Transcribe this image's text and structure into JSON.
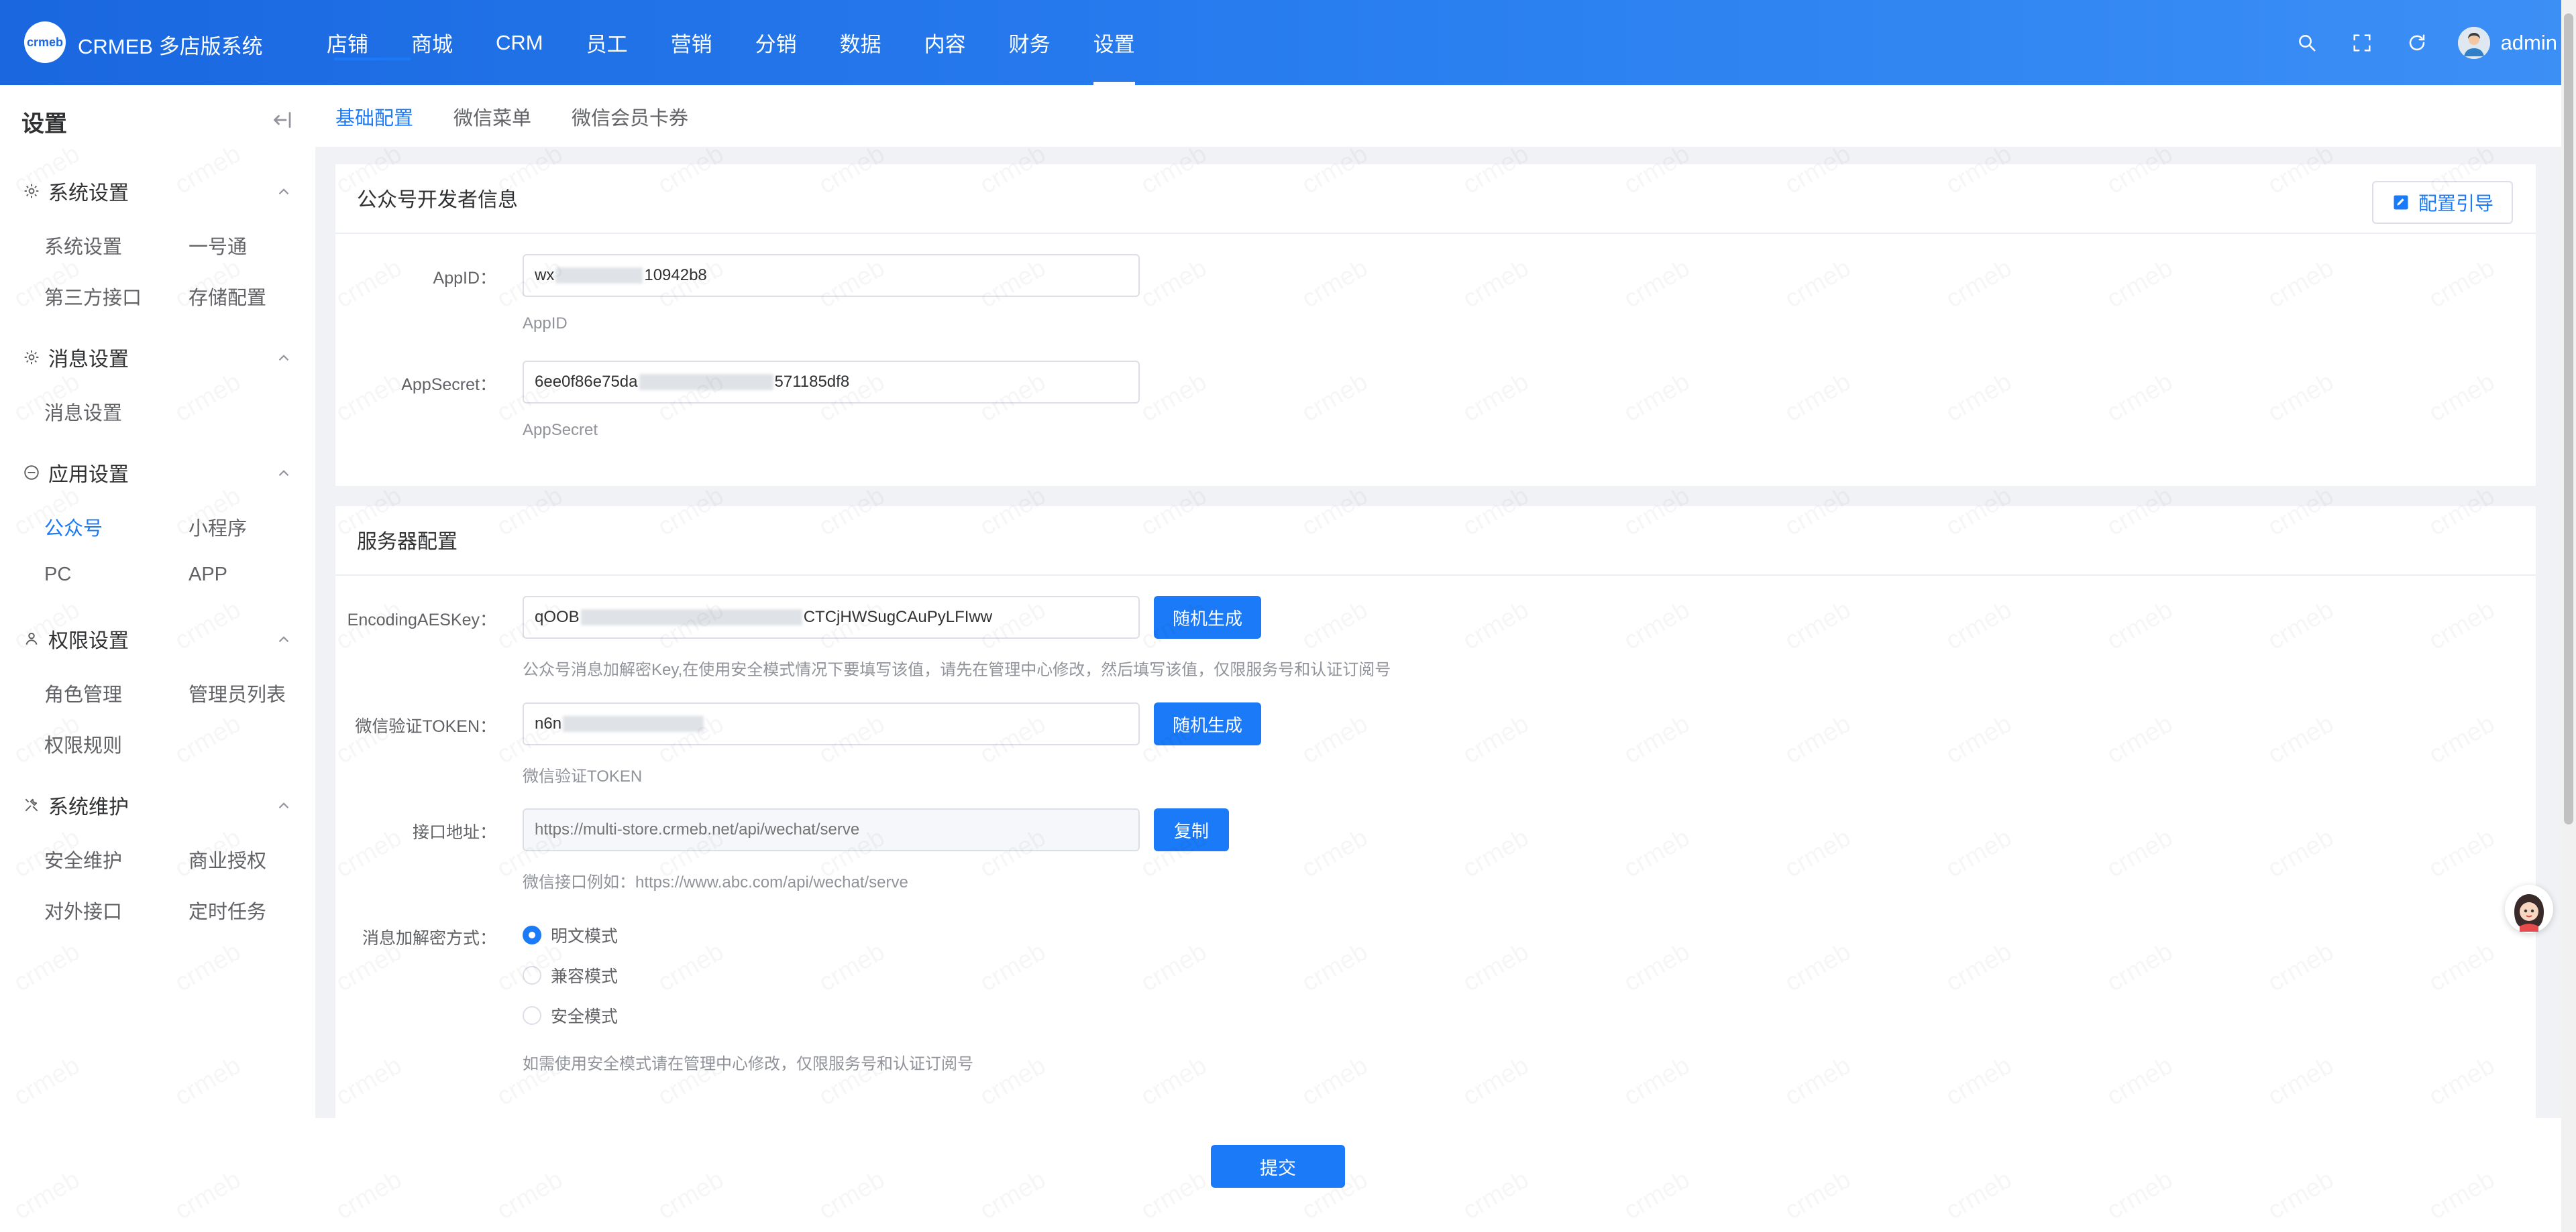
{
  "app": {
    "logo_text": "crmeb",
    "brand": "CRMEB 多店版系统"
  },
  "topnav": [
    "店铺",
    "商城",
    "CRM",
    "员工",
    "营销",
    "分销",
    "数据",
    "内容",
    "财务",
    "设置"
  ],
  "topnav_active": "设置",
  "header": {
    "username": "admin",
    "icons": [
      "search-icon",
      "fullscreen-icon",
      "refresh-icon",
      "user-avatar"
    ]
  },
  "sidebar": {
    "title": "设置",
    "groups": [
      {
        "label": "系统设置",
        "icon": "gear-icon",
        "items": [
          "系统设置",
          "一号通",
          "第三方接口",
          "存储配置"
        ]
      },
      {
        "label": "消息设置",
        "icon": "gear-icon",
        "items": [
          "消息设置"
        ]
      },
      {
        "label": "应用设置",
        "icon": "app-icon",
        "items": [
          "公众号",
          "小程序",
          "PC",
          "APP"
        ]
      },
      {
        "label": "权限设置",
        "icon": "user-icon",
        "items": [
          "角色管理",
          "管理员列表",
          "权限规则"
        ]
      },
      {
        "label": "系统维护",
        "icon": "tools-icon",
        "items": [
          "安全维护",
          "商业授权",
          "对外接口",
          "定时任务"
        ]
      }
    ],
    "active_item": "公众号"
  },
  "tabs": [
    "基础配置",
    "微信菜单",
    "微信会员卡券"
  ],
  "tabs_active": "基础配置",
  "developer": {
    "title": "公众号开发者信息",
    "guide_button": "配置引导",
    "appid_label": "AppID：",
    "appid_prefix": "wx",
    "appid_suffix": "10942b8",
    "appid_help": "AppID",
    "appsecret_label": "AppSecret：",
    "appsecret_prefix": "6ee0f86e75da",
    "appsecret_suffix": "571185df8",
    "appsecret_help": "AppSecret"
  },
  "server": {
    "title": "服务器配置",
    "aeskey_label": "EncodingAESKey：",
    "aeskey_prefix": "qOOB",
    "aeskey_suffix": "CTCjHWSugCAuPyLFIww",
    "aeskey_button": "随机生成",
    "aeskey_help": "公众号消息加解密Key,在使用安全模式情况下要填写该值，请先在管理中心修改，然后填写该值，仅限服务号和认证订阅号",
    "token_label": "微信验证TOKEN：",
    "token_prefix": "n6n",
    "token_button": "随机生成",
    "token_help": "微信验证TOKEN",
    "url_label": "接口地址：",
    "url_placeholder": "https://multi-store.crmeb.net/api/wechat/serve",
    "url_button": "复制",
    "url_help": "微信接口例如：https://www.abc.com/api/wechat/serve",
    "encrypt_label": "消息加解密方式：",
    "encrypt_options": [
      "明文模式",
      "兼容模式",
      "安全模式"
    ],
    "encrypt_selected": "明文模式",
    "encrypt_help": "如需使用安全模式请在管理中心修改，仅限服务号和认证订阅号"
  },
  "footer": {
    "submit": "提交"
  },
  "colors": {
    "primary": "#1a7af8",
    "header_start": "#1a67e0",
    "header_end": "#3c8ff5"
  }
}
